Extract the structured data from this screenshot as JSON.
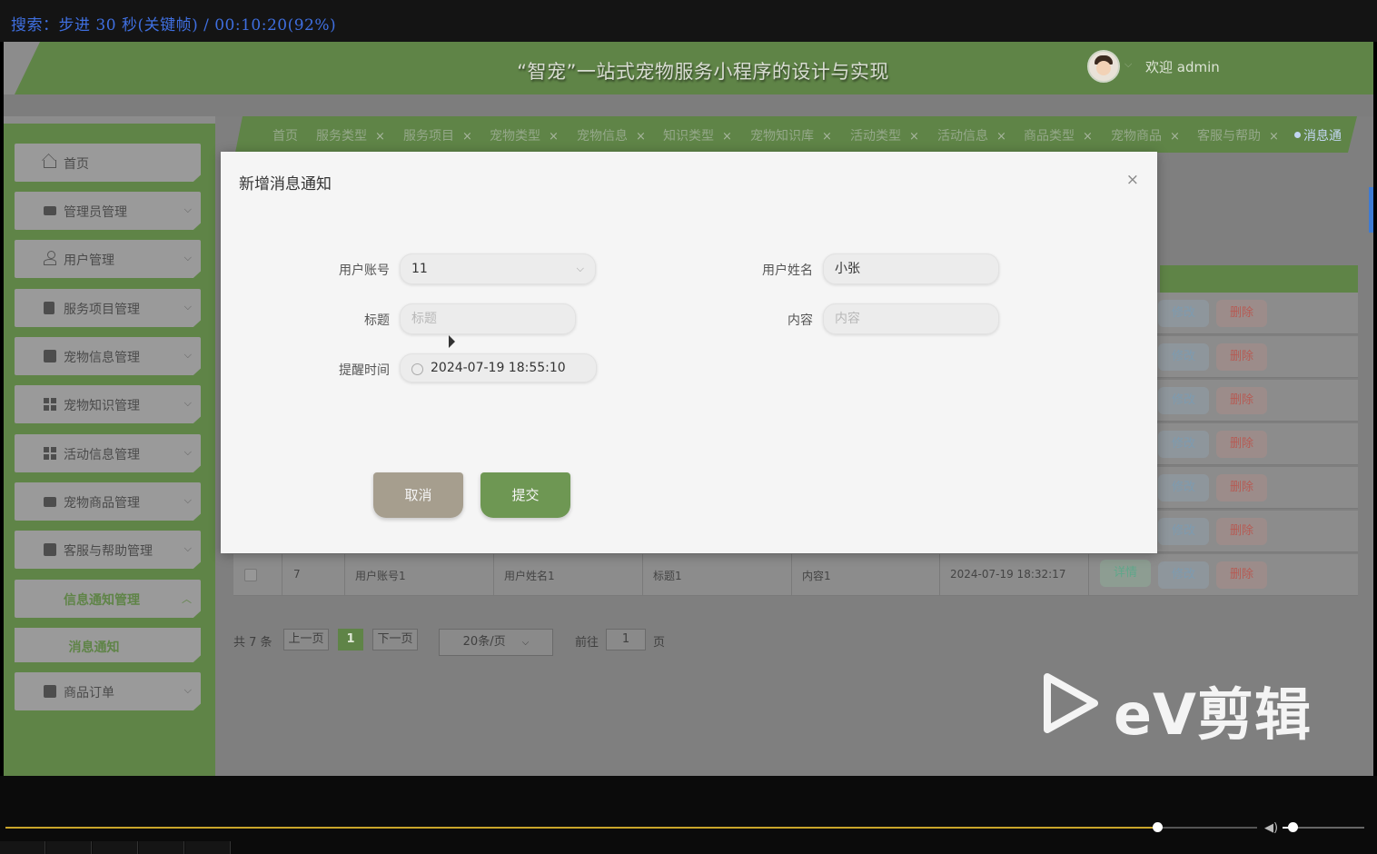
{
  "player": {
    "status_text": "搜索：步进 30 秒(关键帧) / 00:10:20(92%)",
    "progress": 0.92
  },
  "header": {
    "title": "“智宠”一站式宠物服务小程序的设计与实现",
    "welcome": "欢迎 admin"
  },
  "sidebar": {
    "items": [
      {
        "label": "首页",
        "icon": "home-icon"
      },
      {
        "label": "管理员管理",
        "icon": "card-icon"
      },
      {
        "label": "用户管理",
        "icon": "user-icon"
      },
      {
        "label": "服务项目管理",
        "icon": "bookmark-icon"
      },
      {
        "label": "宠物信息管理",
        "icon": "copy-icon"
      },
      {
        "label": "宠物知识管理",
        "icon": "grid-icon"
      },
      {
        "label": "活动信息管理",
        "icon": "layout-icon"
      },
      {
        "label": "宠物商品管理",
        "icon": "shop-icon"
      },
      {
        "label": "客服与帮助管理",
        "icon": "picture-icon"
      },
      {
        "label": "信息通知管理",
        "icon": "apps-icon"
      },
      {
        "label": "消息通知",
        "icon": ""
      },
      {
        "label": "商品订单",
        "icon": "server-icon"
      }
    ]
  },
  "tabs": [
    {
      "label": "首页",
      "closable": false
    },
    {
      "label": "服务类型",
      "closable": true
    },
    {
      "label": "服务项目",
      "closable": true
    },
    {
      "label": "宠物类型",
      "closable": true
    },
    {
      "label": "宠物信息",
      "closable": true
    },
    {
      "label": "知识类型",
      "closable": true
    },
    {
      "label": "宠物知识库",
      "closable": true
    },
    {
      "label": "活动类型",
      "closable": true
    },
    {
      "label": "活动信息",
      "closable": true
    },
    {
      "label": "商品类型",
      "closable": true
    },
    {
      "label": "宠物商品",
      "closable": true
    },
    {
      "label": "客服与帮助",
      "closable": true
    },
    {
      "label": "消息通",
      "closable": false
    }
  ],
  "table": {
    "edit_label": "修改",
    "delete_label": "删除",
    "detail_label": "详情",
    "last_row": {
      "index": "7",
      "account": "用户账号1",
      "name": "用户姓名1",
      "title": "标题1",
      "content": "内容1",
      "time": "2024-07-19 18:32:17"
    }
  },
  "pager": {
    "total": "共 7 条",
    "prev": "上一页",
    "current": "1",
    "next": "下一页",
    "page_size": "20条/页",
    "goto_label": "前往",
    "goto_value": "1",
    "page_unit": "页"
  },
  "modal": {
    "title": "新增消息通知",
    "close": "×",
    "fields": {
      "account_label": "用户账号",
      "account_value": "11",
      "name_label": "用户姓名",
      "name_value": "小张",
      "title_label": "标题",
      "title_placeholder": "标题",
      "content_label": "内容",
      "content_placeholder": "内容",
      "time_label": "提醒时间",
      "time_value": "2024-07-19 18:55:10"
    },
    "cancel": "取消",
    "submit": "提交"
  },
  "watermark": {
    "text": "eV剪辑"
  },
  "colors": {
    "brand_green": "#5f8447",
    "submit_green": "#6e9753",
    "cancel_tan": "#a69e8e",
    "player_text_blue": "#3f6fe0"
  }
}
